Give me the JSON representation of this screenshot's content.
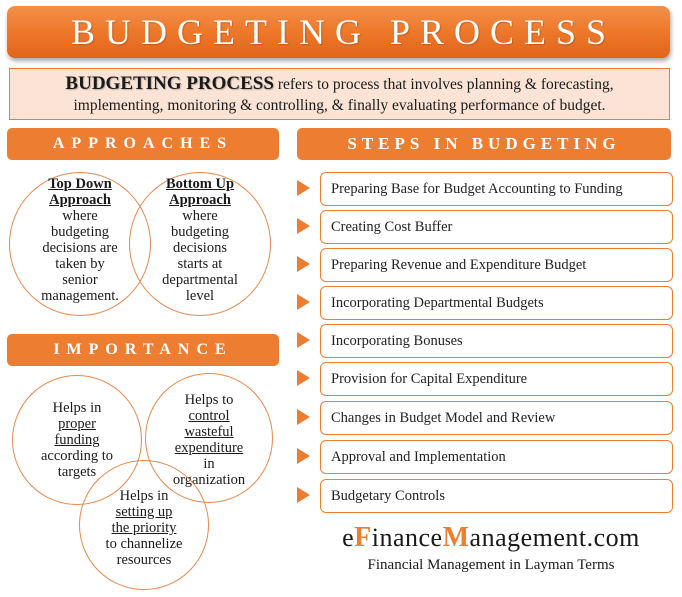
{
  "title": "BUDGETING PROCESS",
  "definition": {
    "term": "BUDGETING PROCESS",
    "text_line1": " refers to process that involves planning & forecasting,",
    "text_line2": "implementing, monitoring & controlling, & finally evaluating performance of  budget."
  },
  "approaches": {
    "header": "APPROACHES",
    "items": [
      {
        "title_line1": "Top Down",
        "title_line2": "Approach",
        "lines": [
          "where",
          "budgeting",
          "decisions are",
          "taken by",
          "senior",
          "management."
        ]
      },
      {
        "title_line1": "Bottom Up",
        "title_line2": "Approach",
        "lines": [
          "where",
          "budgeting",
          "decisions",
          "starts at",
          "departmental",
          "level"
        ]
      }
    ]
  },
  "importance": {
    "header": "IMPORTANCE",
    "items": [
      {
        "pre": "Helps in",
        "underlined": [
          "proper",
          "funding"
        ],
        "post": [
          "according to",
          "targets"
        ]
      },
      {
        "pre": "Helps to",
        "underlined": [
          "control",
          "wasteful",
          "expenditure"
        ],
        "post": [
          "in",
          "organization"
        ]
      },
      {
        "pre": "Helps in",
        "underlined": [
          "setting up",
          "the priority"
        ],
        "post": [
          "to channelize",
          "resources"
        ]
      }
    ]
  },
  "steps": {
    "header": "STEPS IN BUDGETING",
    "items": [
      "Preparing Base for Budget Accounting to Funding",
      "Creating Cost Buffer",
      "Preparing Revenue and Expenditure Budget",
      "Incorporating Departmental Budgets",
      "Incorporating Bonuses",
      "Provision for Capital Expenditure",
      "Changes in Budget Model and Review",
      "Approval and Implementation",
      "Budgetary Controls"
    ]
  },
  "branding": {
    "part1": "e",
    "accent1": "F",
    "part2": "inance",
    "accent2": "M",
    "part3": "anagement.com",
    "tagline": "Financial Management in Layman Terms"
  },
  "colors": {
    "accent": "#ed7d31",
    "definition_bg": "#fbe4d6"
  }
}
